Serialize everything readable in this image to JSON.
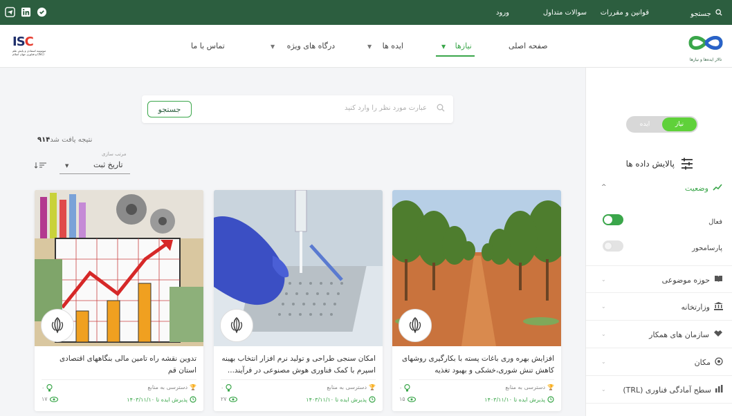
{
  "topbar": {
    "search_label": "جستجو",
    "laws_label": "قوانین و مقررات",
    "faq_label": "سوالات متداول",
    "login_label": "ورود"
  },
  "header": {
    "isc_logo_text": "ISC",
    "isc_logo_sub": "موسسه استنادی و پایش علم و فناوری جهان اسلام (ISC)",
    "brand_name": "تالار ایده‌ها و نیازها",
    "nav": {
      "home": "صفحه اصلی",
      "needs": "نیازها",
      "ideas": "ایده ها",
      "portals": "درگاه های ویژه",
      "contact": "تماس با ما"
    }
  },
  "search": {
    "placeholder": "عبارت مورد نظر را وارد کنید",
    "button": "جستجو"
  },
  "results": {
    "count": "۹۱۴",
    "text": "نتیجه یافت شد"
  },
  "sort": {
    "label": "مرتب سازی",
    "value": "تاریخ ثبت"
  },
  "cards": [
    {
      "title": "افزایش بهره وری باغات پسته با بکارگیری روشهای کاهش تنش شوری،خشکی و بهبود تغذیه",
      "access": "دسترسی به منابع",
      "deadline": "پذیرش ایده تا ۱۴۰۳/۱۱/۱۰",
      "likes": "۰",
      "views": "۱۵"
    },
    {
      "title": "امکان سنجی طراحی و تولید نرم افزار انتخاب بهینه اسپرم با کمک فناوری هوش مصنوعی در فرآیند...",
      "access": "دسترسی به منابع",
      "deadline": "پذیرش ایده تا ۱۴۰۳/۱۱/۱۰",
      "likes": "۰",
      "views": "۲۷"
    },
    {
      "title": "تدوین نقشه راه تامین مالی بنگاههای اقتصادی استان قم",
      "access": "دسترسی به منابع",
      "deadline": "پذیرش ایده تا ۱۴۰۳/۱۱/۱۰",
      "likes": "۰",
      "views": "۱۷"
    }
  ],
  "sidebar": {
    "toggle_on": "نیاز",
    "toggle_off": "ایده",
    "filter_title": "پالایش داده ها",
    "status_label": "وضعیت",
    "active_label": "فعال",
    "parsamehvar_label": "پارسامحور",
    "filters": [
      "حوزه موضوعی",
      "وزارتخانه",
      "سازمان های همکار",
      "مکان",
      "سطح آمادگی فناوری (TRL)"
    ]
  },
  "colors": {
    "topbar": "#2c5e3f",
    "accent": "#3aa64a",
    "toggle_on": "#5fd13a"
  }
}
